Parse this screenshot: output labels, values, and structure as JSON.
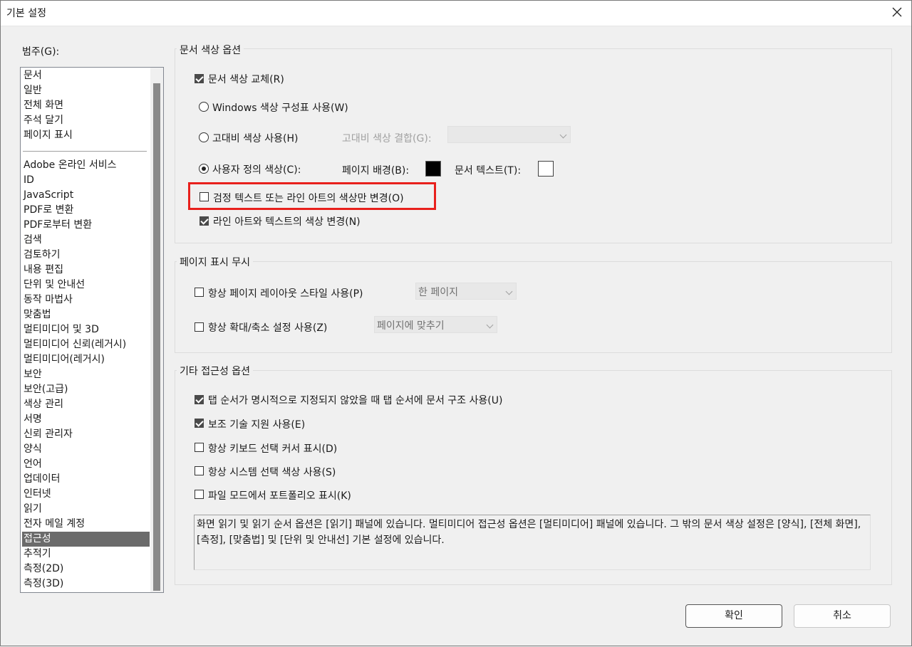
{
  "window": {
    "title": "기본 설정"
  },
  "sidebar": {
    "label": "범주(G):",
    "group_a": [
      "문서",
      "일반",
      "전체 화면",
      "주석 달기",
      "페이지 표시"
    ],
    "group_b": [
      "Adobe 온라인 서비스",
      "ID",
      "JavaScript",
      "PDF로 변환",
      "PDF로부터 변환",
      "검색",
      "검토하기",
      "내용 편집",
      "단위 및 안내선",
      "동작 마법사",
      "맞춤법",
      "멀티미디어 및 3D",
      "멀티미디어 신뢰(레거시)",
      "멀티미디어(레거시)",
      "보안",
      "보안(고급)",
      "색상 관리",
      "서명",
      "신뢰 관리자",
      "양식",
      "언어",
      "업데이터",
      "인터넷",
      "읽기",
      "전자 메일 계정",
      "접근성",
      "추적기",
      "측정(2D)",
      "측정(3D)"
    ],
    "selected": "접근성"
  },
  "doc_color": {
    "title": "문서 색상 옵션",
    "replace": {
      "label": "문서 색상 교체(R)",
      "checked": true
    },
    "windows_scheme": {
      "label": "Windows 색상 구성표 사용(W)",
      "selected": false
    },
    "high_contrast": {
      "label": "고대비 색상 사용(H)",
      "selected": false,
      "combo_label": "고대비 색상 결합(G):",
      "combo_value": ""
    },
    "custom": {
      "label": "사용자 정의 색상(C):",
      "selected": true,
      "page_bg_label": "페이지 배경(B):",
      "page_bg_color": "#000000",
      "doc_text_label": "문서 텍스트(T):",
      "doc_text_color": "#ffffff"
    },
    "black_only": {
      "label": "검정 텍스트 또는 라인 아트의 색상만 변경(O)",
      "checked": false
    },
    "line_art": {
      "label": "라인 아트와 텍스트의 색상 변경(N)",
      "checked": true
    }
  },
  "override": {
    "title": "페이지 표시 무시",
    "layout": {
      "label": "항상 페이지 레이아웃 스타일 사용(P)",
      "checked": false,
      "value": "한 페이지"
    },
    "zoom": {
      "label": "항상 확대/축소 설정 사용(Z)",
      "checked": false,
      "value": "페이지에 맞추기"
    }
  },
  "other": {
    "title": "기타 접근성 옵션",
    "opt1": {
      "label": "탭 순서가 명시적으로 지정되지 않았을 때 탭 순서에 문서 구조 사용(U)",
      "checked": true
    },
    "opt2": {
      "label": "보조 기술 지원 사용(E)",
      "checked": true
    },
    "opt3": {
      "label": "항상 키보드 선택 커서 표시(D)",
      "checked": false
    },
    "opt4": {
      "label": "항상 시스템 선택 색상 사용(S)",
      "checked": false
    },
    "opt5": {
      "label": "파일 모드에서 포트폴리오 표시(K)",
      "checked": false
    },
    "note": "화면 읽기 및 읽기 순서 옵션은 [읽기] 패널에 있습니다. 멀티미디어 접근성 옵션은 [멀티미디어] 패널에 있습니다. 그 밖의 문서 색상 설정은 [양식], [전체 화면], [측정], [맞춤법] 및 [단위 및 안내선] 기본 설정에 있습니다."
  },
  "buttons": {
    "ok": "확인",
    "cancel": "취소"
  }
}
